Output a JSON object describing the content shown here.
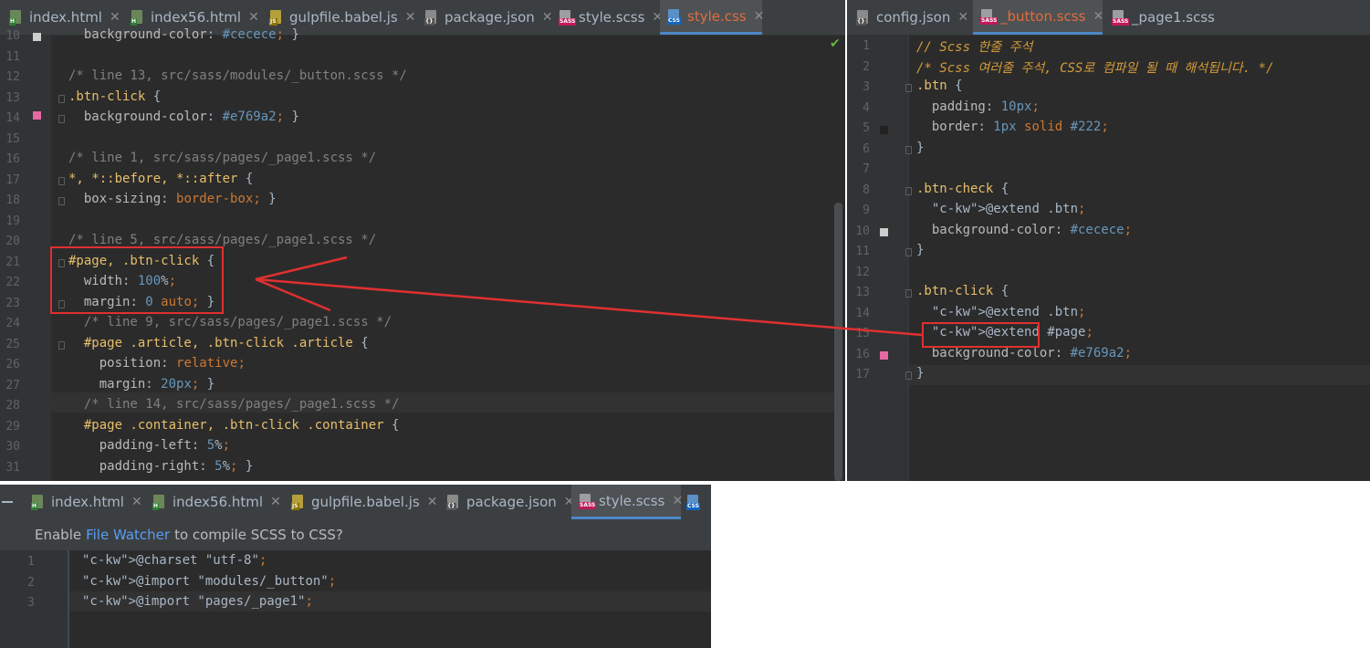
{
  "left_editor": {
    "tabs": [
      {
        "label": "index.html",
        "icon": "html-file-icon"
      },
      {
        "label": "index56.html",
        "icon": "html-file-icon"
      },
      {
        "label": "gulpfile.babel.js",
        "icon": "js-file-icon"
      },
      {
        "label": "package.json",
        "icon": "json-file-icon"
      },
      {
        "label": "style.scss",
        "icon": "sass-file-icon"
      },
      {
        "label": "style.css",
        "icon": "css-file-icon",
        "active": true
      }
    ],
    "lines": [
      {
        "n": "10",
        "code": "  background-color: #cecece; }"
      },
      {
        "n": "11",
        "code": ""
      },
      {
        "n": "12",
        "code": "/* line 13, src/sass/modules/_button.scss */"
      },
      {
        "n": "13",
        "code": ".btn-click {"
      },
      {
        "n": "14",
        "code": "  background-color: #e769a2; }"
      },
      {
        "n": "15",
        "code": ""
      },
      {
        "n": "16",
        "code": "/* line 1, src/sass/pages/_page1.scss */"
      },
      {
        "n": "17",
        "code": "*, *::before, *::after {"
      },
      {
        "n": "18",
        "code": "  box-sizing: border-box; }"
      },
      {
        "n": "19",
        "code": ""
      },
      {
        "n": "20",
        "code": "/* line 5, src/sass/pages/_page1.scss */"
      },
      {
        "n": "21",
        "code": "#page, .btn-click {"
      },
      {
        "n": "22",
        "code": "  width: 100%;"
      },
      {
        "n": "23",
        "code": "  margin: 0 auto; }"
      },
      {
        "n": "24",
        "code": "  /* line 9, src/sass/pages/_page1.scss */"
      },
      {
        "n": "25",
        "code": "  #page .article, .btn-click .article {"
      },
      {
        "n": "26",
        "code": "    position: relative;"
      },
      {
        "n": "27",
        "code": "    margin: 20px; }"
      },
      {
        "n": "28",
        "code": "  /* line 14, src/sass/pages/_page1.scss */"
      },
      {
        "n": "29",
        "code": "  #page .container, .btn-click .container {"
      },
      {
        "n": "30",
        "code": "    padding-left: 5%;"
      },
      {
        "n": "31",
        "code": "    padding-right: 5%; }"
      }
    ],
    "colors": {
      "swatch_14": "#e769a2",
      "swatch_10": "#cecece"
    }
  },
  "right_editor": {
    "tabs": [
      {
        "label": "config.json",
        "icon": "json-file-icon"
      },
      {
        "label": "_button.scss",
        "icon": "sass-file-icon",
        "active": true
      },
      {
        "label": "_page1.scss",
        "icon": "sass-file-icon"
      }
    ],
    "lines": [
      {
        "n": "1",
        "code": "// Scss 한줄 주석"
      },
      {
        "n": "2",
        "code": "/* Scss 여러줄 주석, CSS로 컴파일 될 때 해석됩니다. */"
      },
      {
        "n": "3",
        "code": ".btn {"
      },
      {
        "n": "4",
        "code": "  padding: 10px;"
      },
      {
        "n": "5",
        "code": "  border: 1px solid #222;"
      },
      {
        "n": "6",
        "code": "}"
      },
      {
        "n": "7",
        "code": ""
      },
      {
        "n": "8",
        "code": ".btn-check {"
      },
      {
        "n": "9",
        "code": "  @extend .btn;"
      },
      {
        "n": "10",
        "code": "  background-color: #cecece;"
      },
      {
        "n": "11",
        "code": "}"
      },
      {
        "n": "12",
        "code": ""
      },
      {
        "n": "13",
        "code": ".btn-click {"
      },
      {
        "n": "14",
        "code": "  @extend .btn;"
      },
      {
        "n": "15",
        "code": "  @extend #page;"
      },
      {
        "n": "16",
        "code": "  background-color: #e769a2;"
      },
      {
        "n": "17",
        "code": "}"
      }
    ],
    "colors": {
      "swatch_5": "#222222",
      "swatch_10": "#cecece",
      "swatch_16": "#e769a2"
    }
  },
  "bottom_editor": {
    "tabs": [
      {
        "label": "index.html",
        "icon": "html-file-icon"
      },
      {
        "label": "index56.html",
        "icon": "html-file-icon"
      },
      {
        "label": "gulpfile.babel.js",
        "icon": "js-file-icon"
      },
      {
        "label": "package.json",
        "icon": "json-file-icon"
      },
      {
        "label": "style.scss",
        "icon": "sass-file-icon",
        "active": true
      },
      {
        "label": "",
        "icon": "css-file-icon"
      }
    ],
    "banner": {
      "prefix": "Enable",
      "link": "File Watcher",
      "suffix": "to compile SCSS to CSS?"
    },
    "lines": [
      {
        "n": "1",
        "code": "@charset \"utf-8\";"
      },
      {
        "n": "2",
        "code": "@import \"modules/_button\";"
      },
      {
        "n": "3",
        "code": "@import \"pages/_page1\";"
      }
    ]
  },
  "annotation_color": "#e03030"
}
